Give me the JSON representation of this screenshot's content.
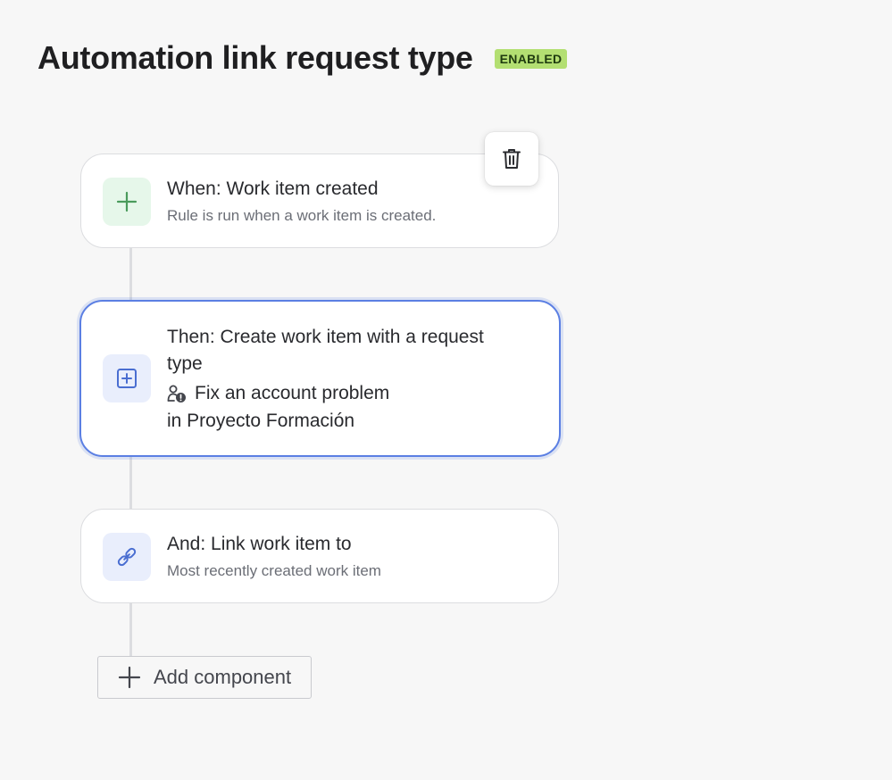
{
  "header": {
    "title": "Automation link request type",
    "status": "ENABLED"
  },
  "rule": {
    "trigger": {
      "title": "When: Work item created",
      "description": "Rule is run when a work item is created.",
      "icon": "plus-icon"
    },
    "action": {
      "title_line1": "Then: Create work item with a request",
      "title_line2": "type",
      "request_type": "Fix an account problem",
      "project": "in Proyecto Formación",
      "icon": "add-square-icon",
      "request_type_icon": "user-alert-icon"
    },
    "branch": {
      "title": "And: Link work item to",
      "description": "Most recently created work item",
      "icon": "link-icon"
    }
  },
  "toolbar": {
    "delete_icon": "trash-icon"
  },
  "add_component": {
    "label": "Add component"
  },
  "colors": {
    "accent": "#5b7fe3",
    "badge": "#b3df72",
    "trigger_icon": "#4a9b5c",
    "action_icon": "#4a6ed1"
  }
}
